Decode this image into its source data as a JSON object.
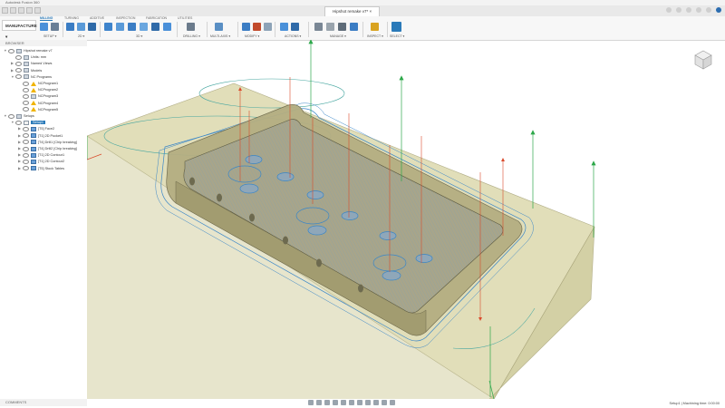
{
  "window": {
    "title": "Autodesk Fusion 360"
  },
  "doc_tab": {
    "label": "Hipshot remake v7*"
  },
  "workspace": {
    "label": "MANUFACTURE ▾"
  },
  "ribbon": {
    "tabs": [
      "MILLING",
      "TURNING",
      "ADDITIVE",
      "INSPECTION",
      "FABRICATION",
      "UTILITIES"
    ],
    "groups": [
      "SETUP ▾",
      "2D ▾",
      "3D ▾",
      "DRILLING ▾",
      "MULTI-AXIS ▾",
      "MODIFY ▾",
      "ACTIONS ▾",
      "MANAGE ▾",
      "INSPECT ▾",
      "SELECT ▾"
    ]
  },
  "browser": {
    "header": "BROWSER",
    "items": [
      {
        "label": "Hipshot remake v7",
        "level": 0,
        "exp": "▼",
        "icon": "doc"
      },
      {
        "label": "Units: mm",
        "level": 1,
        "exp": "",
        "icon": "doc"
      },
      {
        "label": "Named Views",
        "level": 1,
        "exp": "▶",
        "icon": "folder"
      },
      {
        "label": "Models",
        "level": 1,
        "exp": "▶",
        "icon": "folder"
      },
      {
        "label": "NC Programs",
        "level": 1,
        "exp": "▼",
        "icon": "folder"
      },
      {
        "label": "NCProgram1",
        "level": 2,
        "exp": "",
        "icon": "warn"
      },
      {
        "label": "NCProgram2",
        "level": 2,
        "exp": "",
        "icon": "warn"
      },
      {
        "label": "NCProgram3",
        "level": 2,
        "exp": "",
        "icon": "doc"
      },
      {
        "label": "NCProgram4",
        "level": 2,
        "exp": "",
        "icon": "warn"
      },
      {
        "label": "NCProgram5",
        "level": 2,
        "exp": "",
        "icon": "warn"
      },
      {
        "label": "Setups",
        "level": 0,
        "exp": "▼",
        "icon": "folder"
      },
      {
        "label": "Setup1",
        "level": 1,
        "exp": "▼",
        "icon": "setup",
        "selected": true
      },
      {
        "label": "[T5] Face2",
        "level": 2,
        "exp": "▶",
        "icon": "op"
      },
      {
        "label": "[T1] 2D Pocket1",
        "level": 2,
        "exp": "▶",
        "icon": "op"
      },
      {
        "label": "[T4] Drill1 [Chip breaking]",
        "level": 2,
        "exp": "▶",
        "icon": "op"
      },
      {
        "label": "[T4] Drill2 [Chip breaking]",
        "level": 2,
        "exp": "▶",
        "icon": "op"
      },
      {
        "label": "[T1] 2D Contour1",
        "level": 2,
        "exp": "▶",
        "icon": "op"
      },
      {
        "label": "[T1] 2D Contour2",
        "level": 2,
        "exp": "▶",
        "icon": "op"
      },
      {
        "label": "[T5] Stock Tables",
        "level": 2,
        "exp": "▶",
        "icon": "op"
      }
    ]
  },
  "comments": {
    "label": "COMMENTS"
  },
  "status": {
    "text": "Setup1 | Machining time: 0:00:00"
  },
  "colors": {
    "accent": "#2a7ab9",
    "stock": "#d8d4a8",
    "part": "#b7b38a",
    "toolpath": "#3a86c8",
    "retract": "#d94a2b",
    "green_arrow": "#2da84a"
  }
}
